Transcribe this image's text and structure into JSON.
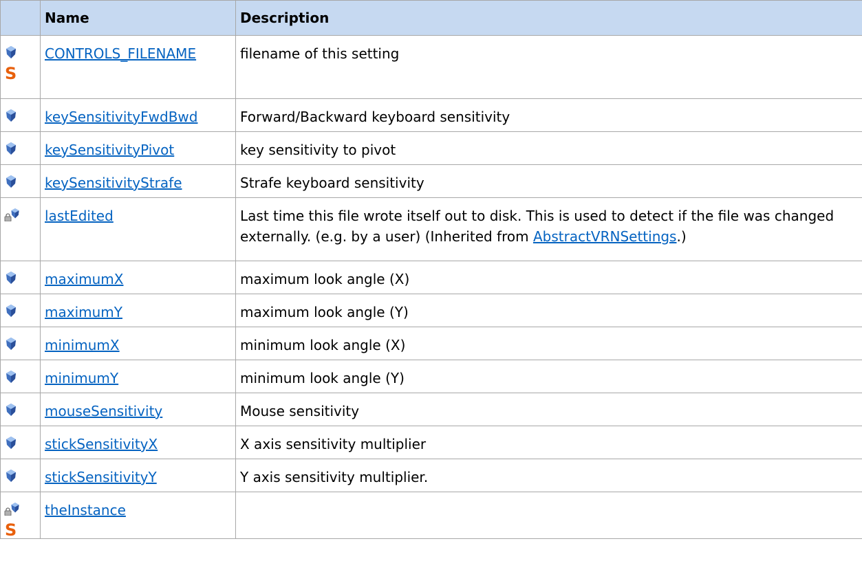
{
  "header": {
    "icon_col": "",
    "name": "Name",
    "description": "Description"
  },
  "rows": [
    {
      "icons": [
        "field-icon",
        "static-icon"
      ],
      "name": "CONTROLS_FILENAME",
      "description": "filename of this setting",
      "link": ""
    },
    {
      "icons": [
        "field-icon"
      ],
      "name": "keySensitivityFwdBwd",
      "description": "Forward/Backward keyboard sensitivity",
      "link": ""
    },
    {
      "icons": [
        "field-icon"
      ],
      "name": "keySensitivityPivot",
      "description": "key sensitivity to pivot",
      "link": ""
    },
    {
      "icons": [
        "field-icon"
      ],
      "name": "keySensitivityStrafe",
      "description": "Strafe keyboard sensitivity",
      "link": ""
    },
    {
      "icons": [
        "protected-field-icon"
      ],
      "name": "lastEdited",
      "description": "Last time this file wrote itself out to disk. This is used to detect if the file was changed externally. (e.g. by a user) (Inherited from ",
      "link": "AbstractVRNSettings",
      "description_suffix": ".)"
    },
    {
      "icons": [
        "field-icon"
      ],
      "name": "maximumX",
      "description": "maximum look angle (X)",
      "link": ""
    },
    {
      "icons": [
        "field-icon"
      ],
      "name": "maximumY",
      "description": "maximum look angle (Y)",
      "link": ""
    },
    {
      "icons": [
        "field-icon"
      ],
      "name": "minimumX",
      "description": "minimum look angle (X)",
      "link": ""
    },
    {
      "icons": [
        "field-icon"
      ],
      "name": "minimumY",
      "description": "minimum look angle (Y)",
      "link": ""
    },
    {
      "icons": [
        "field-icon"
      ],
      "name": "mouseSensitivity",
      "description": "Mouse sensitivity",
      "link": ""
    },
    {
      "icons": [
        "field-icon"
      ],
      "name": "stickSensitivityX",
      "description": "X axis sensitivity multiplier",
      "link": ""
    },
    {
      "icons": [
        "field-icon"
      ],
      "name": "stickSensitivityY",
      "description": "Y axis sensitivity multiplier.",
      "link": ""
    },
    {
      "icons": [
        "protected-field-icon",
        "static-icon"
      ],
      "name": "theInstance",
      "description": "",
      "link": ""
    }
  ],
  "static_glyph": "S",
  "colors": {
    "header_bg": "#c6d9f1",
    "link": "#0563c1",
    "static": "#e8600c",
    "border": "#a7a7a7"
  }
}
